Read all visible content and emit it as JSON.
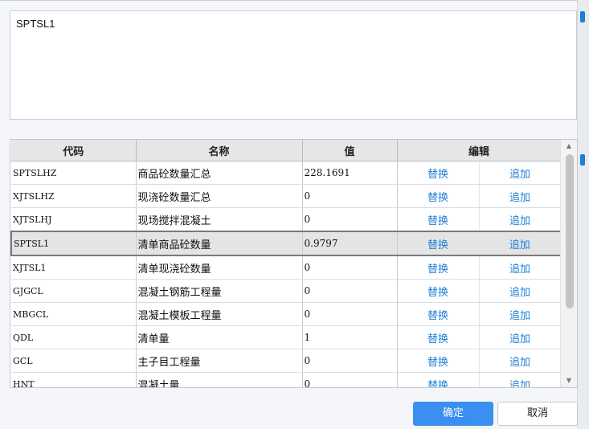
{
  "expression": "SPTSL1",
  "table": {
    "headers": {
      "code": "代码",
      "name": "名称",
      "value": "值",
      "edit": "编辑"
    },
    "rows": [
      {
        "code": "SPTSLHZ",
        "name": "商品砼数量汇总",
        "value": "228.1691",
        "replace": "替换",
        "append": "追加"
      },
      {
        "code": "XJTSLHZ",
        "name": "现浇砼数量汇总",
        "value": "0",
        "replace": "替换",
        "append": "追加"
      },
      {
        "code": "XJTSLHJ",
        "name": "现场搅拌混凝土",
        "value": "0",
        "replace": "替换",
        "append": "追加"
      },
      {
        "code": "SPTSL1",
        "name": "清单商品砼数量",
        "value": "0.9797",
        "replace": "替换",
        "append": "追加"
      },
      {
        "code": "XJTSL1",
        "name": "清单现浇砼数量",
        "value": "0",
        "replace": "替换",
        "append": "追加"
      },
      {
        "code": "GJGCL",
        "name": "混凝土钢筋工程量",
        "value": "0",
        "replace": "替换",
        "append": "追加"
      },
      {
        "code": "MBGCL",
        "name": "混凝土模板工程量",
        "value": "0",
        "replace": "替换",
        "append": "追加"
      },
      {
        "code": "QDL",
        "name": "清单量",
        "value": "1",
        "replace": "替换",
        "append": "追加"
      },
      {
        "code": "GCL",
        "name": "主子目工程量",
        "value": "0",
        "replace": "替换",
        "append": "追加"
      },
      {
        "code": "HNT",
        "name": "混凝土量",
        "value": "0",
        "replace": "替换",
        "append": "追加"
      }
    ],
    "selected_row": 3
  },
  "buttons": {
    "ok": "确定",
    "cancel": "取消"
  },
  "colors": {
    "accent": "#3b8ff0",
    "link": "#1e7fd6",
    "selected_row": "#e4e4e4"
  }
}
